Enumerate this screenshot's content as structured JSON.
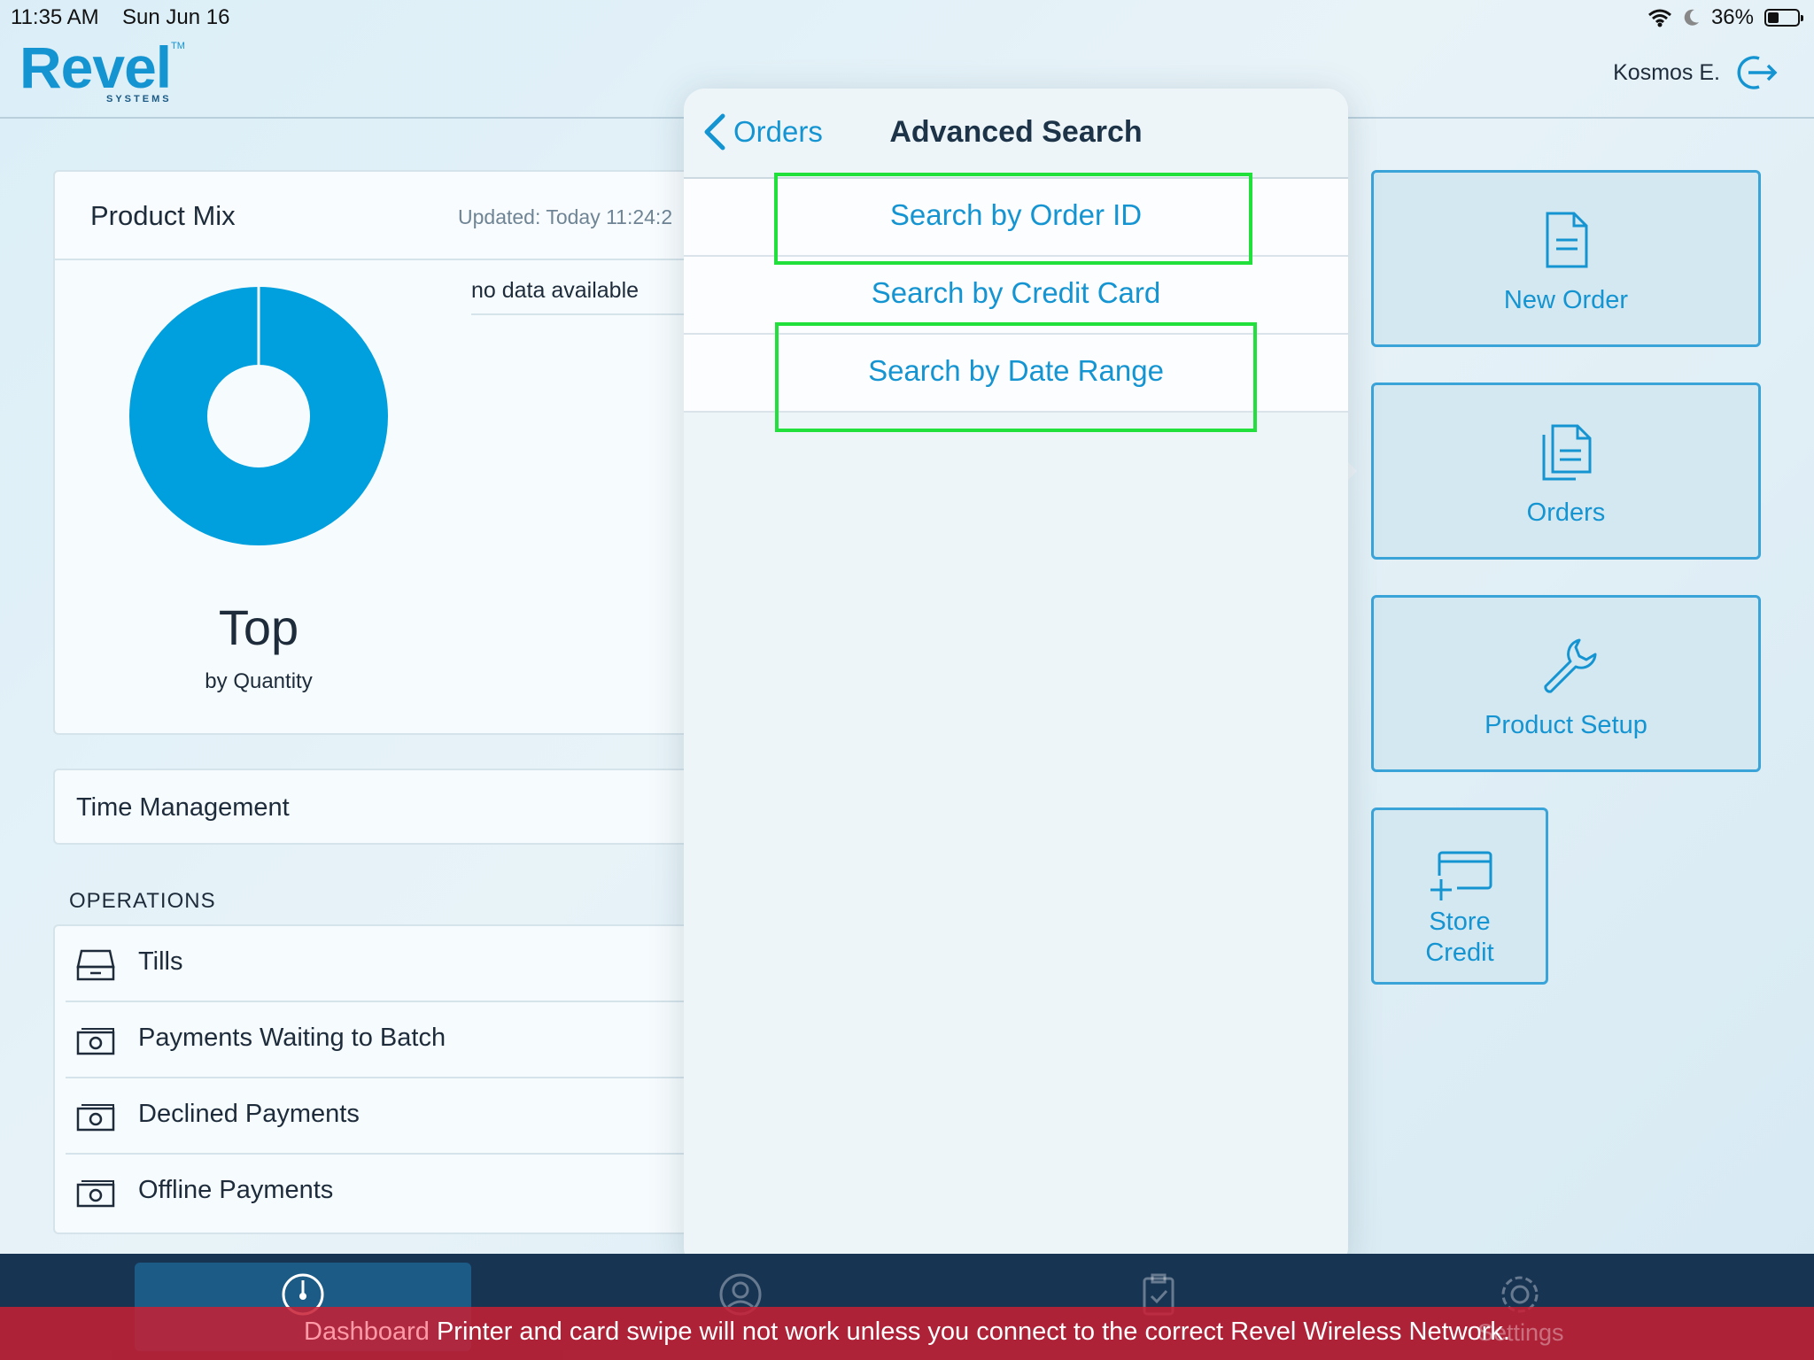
{
  "status_bar": {
    "time": "11:35 AM",
    "date": "Sun Jun 16",
    "battery": "36%",
    "battery_level": 0.36
  },
  "header": {
    "logo": "Revel",
    "logo_sub": "SYSTEMS",
    "logo_tm": "TM",
    "user_name": "Kosmos E."
  },
  "product_mix": {
    "title": "Product Mix",
    "updated": "Updated: Today 11:24:2",
    "no_data": "no data available",
    "top_label": "Top",
    "by_label": "by Quantity"
  },
  "time_management": {
    "label": "Time Management"
  },
  "operations": {
    "heading": "OPERATIONS",
    "items": [
      {
        "label": "Tills",
        "icon": "till-drawer-icon"
      },
      {
        "label": "Payments Waiting to Batch",
        "icon": "cash-icon"
      },
      {
        "label": "Declined Payments",
        "icon": "cash-icon"
      },
      {
        "label": "Offline Payments",
        "icon": "cash-icon"
      }
    ]
  },
  "tiles": [
    {
      "label": "New Order",
      "icon": "document-icon"
    },
    {
      "label": "Orders",
      "icon": "documents-icon"
    },
    {
      "label": "Product Setup",
      "icon": "wrench-icon"
    },
    {
      "label_line1": "Store",
      "label_line2": "Credit",
      "icon": "card-plus-icon"
    }
  ],
  "popover": {
    "back_label": "Orders",
    "title": "Advanced Search",
    "options": [
      {
        "label": "Search by Order ID",
        "highlighted": true
      },
      {
        "label": "Search by Credit Card",
        "highlighted": false
      },
      {
        "label": "Search by Date Range",
        "highlighted": true
      }
    ]
  },
  "tabbar": {
    "dashboard": "Dashboard",
    "settings": "Settings"
  },
  "banner": {
    "message": "Printer and card swipe will not work unless you connect to the correct Revel Wireless Network."
  },
  "colors": {
    "accent": "#1594d2",
    "highlight": "#22e03c",
    "banner": "#c72034",
    "tabbar": "#173453"
  }
}
